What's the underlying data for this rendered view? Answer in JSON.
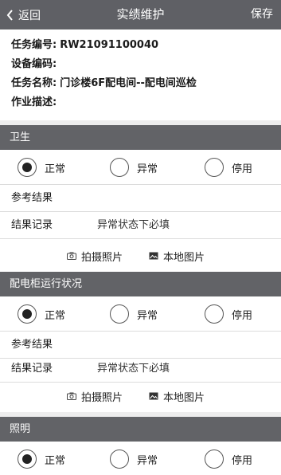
{
  "header": {
    "back_label": "返回",
    "title": "实绩维护",
    "save_label": "保存"
  },
  "task": {
    "number_label": "任务编号:",
    "number_value": "RW21091100040",
    "device_code_label": "设备编码:",
    "device_code_value": "",
    "name_label": "任务名称:",
    "name_value": "门诊楼6F配电间--配电间巡检",
    "desc_label": "作业描述:",
    "desc_value": ""
  },
  "sections": [
    {
      "title": "卫生",
      "options": [
        "正常",
        "异常",
        "停用"
      ],
      "selected": "正常",
      "reference_label": "参考结果",
      "record_label": "结果记录",
      "record_placeholder": "异常状态下必填",
      "photo_label": "拍摄照片",
      "local_label": "本地图片"
    },
    {
      "title": "配电柜运行状况",
      "options": [
        "正常",
        "异常",
        "停用"
      ],
      "selected": "正常",
      "reference_label": "参考结果",
      "record_label": "结果记录",
      "record_placeholder": "异常状态下必填",
      "photo_label": "拍摄照片",
      "local_label": "本地图片"
    },
    {
      "title": "照明",
      "options": [
        "正常",
        "异常",
        "停用"
      ],
      "selected": "正常"
    }
  ],
  "icons": {
    "back": "chevron-left-icon",
    "camera": "camera-icon",
    "image": "image-icon"
  },
  "colors": {
    "header_bg": "#5f6065",
    "section_bg": "#626367",
    "gap_bg": "#ededed"
  }
}
